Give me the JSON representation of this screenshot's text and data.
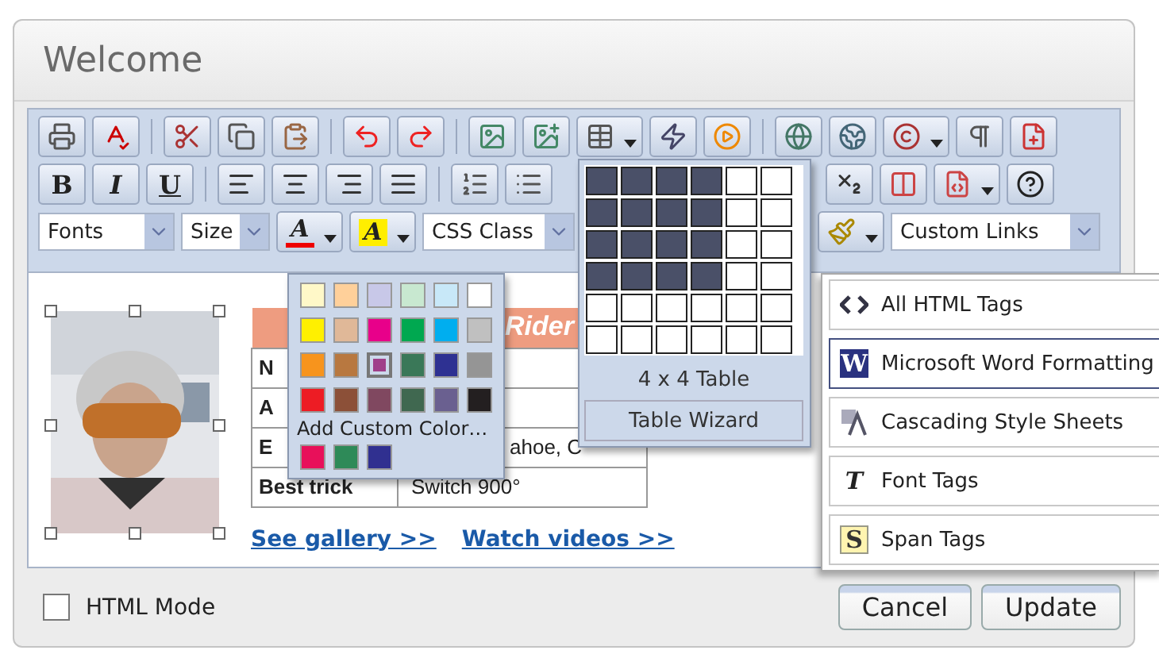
{
  "dialog": {
    "title": "Welcome"
  },
  "toolbar": {
    "bold": "B",
    "italic": "I",
    "underline": "U",
    "font_color": "A",
    "highlight": "A",
    "selects": [
      {
        "value": "Fonts"
      },
      {
        "value": "Size"
      },
      {
        "value": "CSS Class"
      },
      {
        "value": "Custom Links"
      }
    ]
  },
  "content": {
    "header": "Rider",
    "rows": [
      {
        "label": "N"
      },
      {
        "label": "A"
      },
      {
        "label": "E",
        "value": "ahoe, C"
      },
      {
        "label": "Best trick",
        "value": "Switch 900°"
      }
    ],
    "links": [
      "See gallery >>",
      "Watch videos >>"
    ]
  },
  "color_palette": {
    "swatches": [
      {
        "color": "#fff8c8",
        "selected": false
      },
      {
        "color": "#ffd09a",
        "selected": false
      },
      {
        "color": "#c8c8e8",
        "selected": false
      },
      {
        "color": "#c8e8d0",
        "selected": false
      },
      {
        "color": "#c8e8f8",
        "selected": false
      },
      {
        "color": "#ffffff",
        "selected": false
      },
      {
        "color": "#fff000",
        "selected": false
      },
      {
        "color": "#e0b898",
        "selected": false
      },
      {
        "color": "#e8008a",
        "selected": false
      },
      {
        "color": "#00a850",
        "selected": false
      },
      {
        "color": "#00aeef",
        "selected": false
      },
      {
        "color": "#c0c0c0",
        "selected": false
      },
      {
        "color": "#f7941d",
        "selected": false
      },
      {
        "color": "#b87840",
        "selected": false
      },
      {
        "color": "#a0408a",
        "selected": true
      },
      {
        "color": "#3a7858",
        "selected": false
      },
      {
        "color": "#2e3192",
        "selected": false
      },
      {
        "color": "#959595",
        "selected": false
      },
      {
        "color": "#ed1c24",
        "selected": false
      },
      {
        "color": "#8c5038",
        "selected": false
      },
      {
        "color": "#804860",
        "selected": false
      },
      {
        "color": "#406850",
        "selected": false
      },
      {
        "color": "#6a6090",
        "selected": false
      },
      {
        "color": "#231f20",
        "selected": false
      }
    ],
    "add_custom": "Add Custom Color…",
    "custom": [
      {
        "color": "#e8105a",
        "selected": false
      },
      {
        "color": "#2e8a58",
        "selected": false
      },
      {
        "color": "#303090",
        "selected": false
      }
    ]
  },
  "table_picker": {
    "rows": [
      {
        "cells": [
          {
            "selected": true
          },
          {
            "selected": true
          },
          {
            "selected": true
          },
          {
            "selected": true
          },
          {
            "selected": false
          },
          {
            "selected": false
          }
        ]
      },
      {
        "cells": [
          {
            "selected": true
          },
          {
            "selected": true
          },
          {
            "selected": true
          },
          {
            "selected": true
          },
          {
            "selected": false
          },
          {
            "selected": false
          }
        ]
      },
      {
        "cells": [
          {
            "selected": true
          },
          {
            "selected": true
          },
          {
            "selected": true
          },
          {
            "selected": true
          },
          {
            "selected": false
          },
          {
            "selected": false
          }
        ]
      },
      {
        "cells": [
          {
            "selected": true
          },
          {
            "selected": true
          },
          {
            "selected": true
          },
          {
            "selected": true
          },
          {
            "selected": false
          },
          {
            "selected": false
          }
        ]
      },
      {
        "cells": [
          {
            "selected": false
          },
          {
            "selected": false
          },
          {
            "selected": false
          },
          {
            "selected": false
          },
          {
            "selected": false
          },
          {
            "selected": false
          }
        ]
      },
      {
        "cells": [
          {
            "selected": false
          },
          {
            "selected": false
          },
          {
            "selected": false
          },
          {
            "selected": false
          },
          {
            "selected": false
          },
          {
            "selected": false
          }
        ]
      }
    ],
    "size_label": "4 x 4 Table",
    "wizard": "Table Wizard"
  },
  "paste_menu": [
    {
      "kind": "html",
      "label": "All HTML Tags",
      "selected": false
    },
    {
      "kind": "word",
      "glyph": "W",
      "label": "Microsoft Word Formatting",
      "selected": true
    },
    {
      "kind": "css",
      "label": "Cascading Style Sheets",
      "selected": false
    },
    {
      "kind": "font",
      "glyph": "T",
      "label": "Font Tags",
      "selected": false
    },
    {
      "kind": "span",
      "glyph": "S",
      "label": "Span Tags",
      "selected": false
    }
  ],
  "footer": {
    "html_mode": {
      "label": "HTML Mode",
      "checked": false
    },
    "buttons": [
      "Cancel",
      "Update"
    ]
  }
}
